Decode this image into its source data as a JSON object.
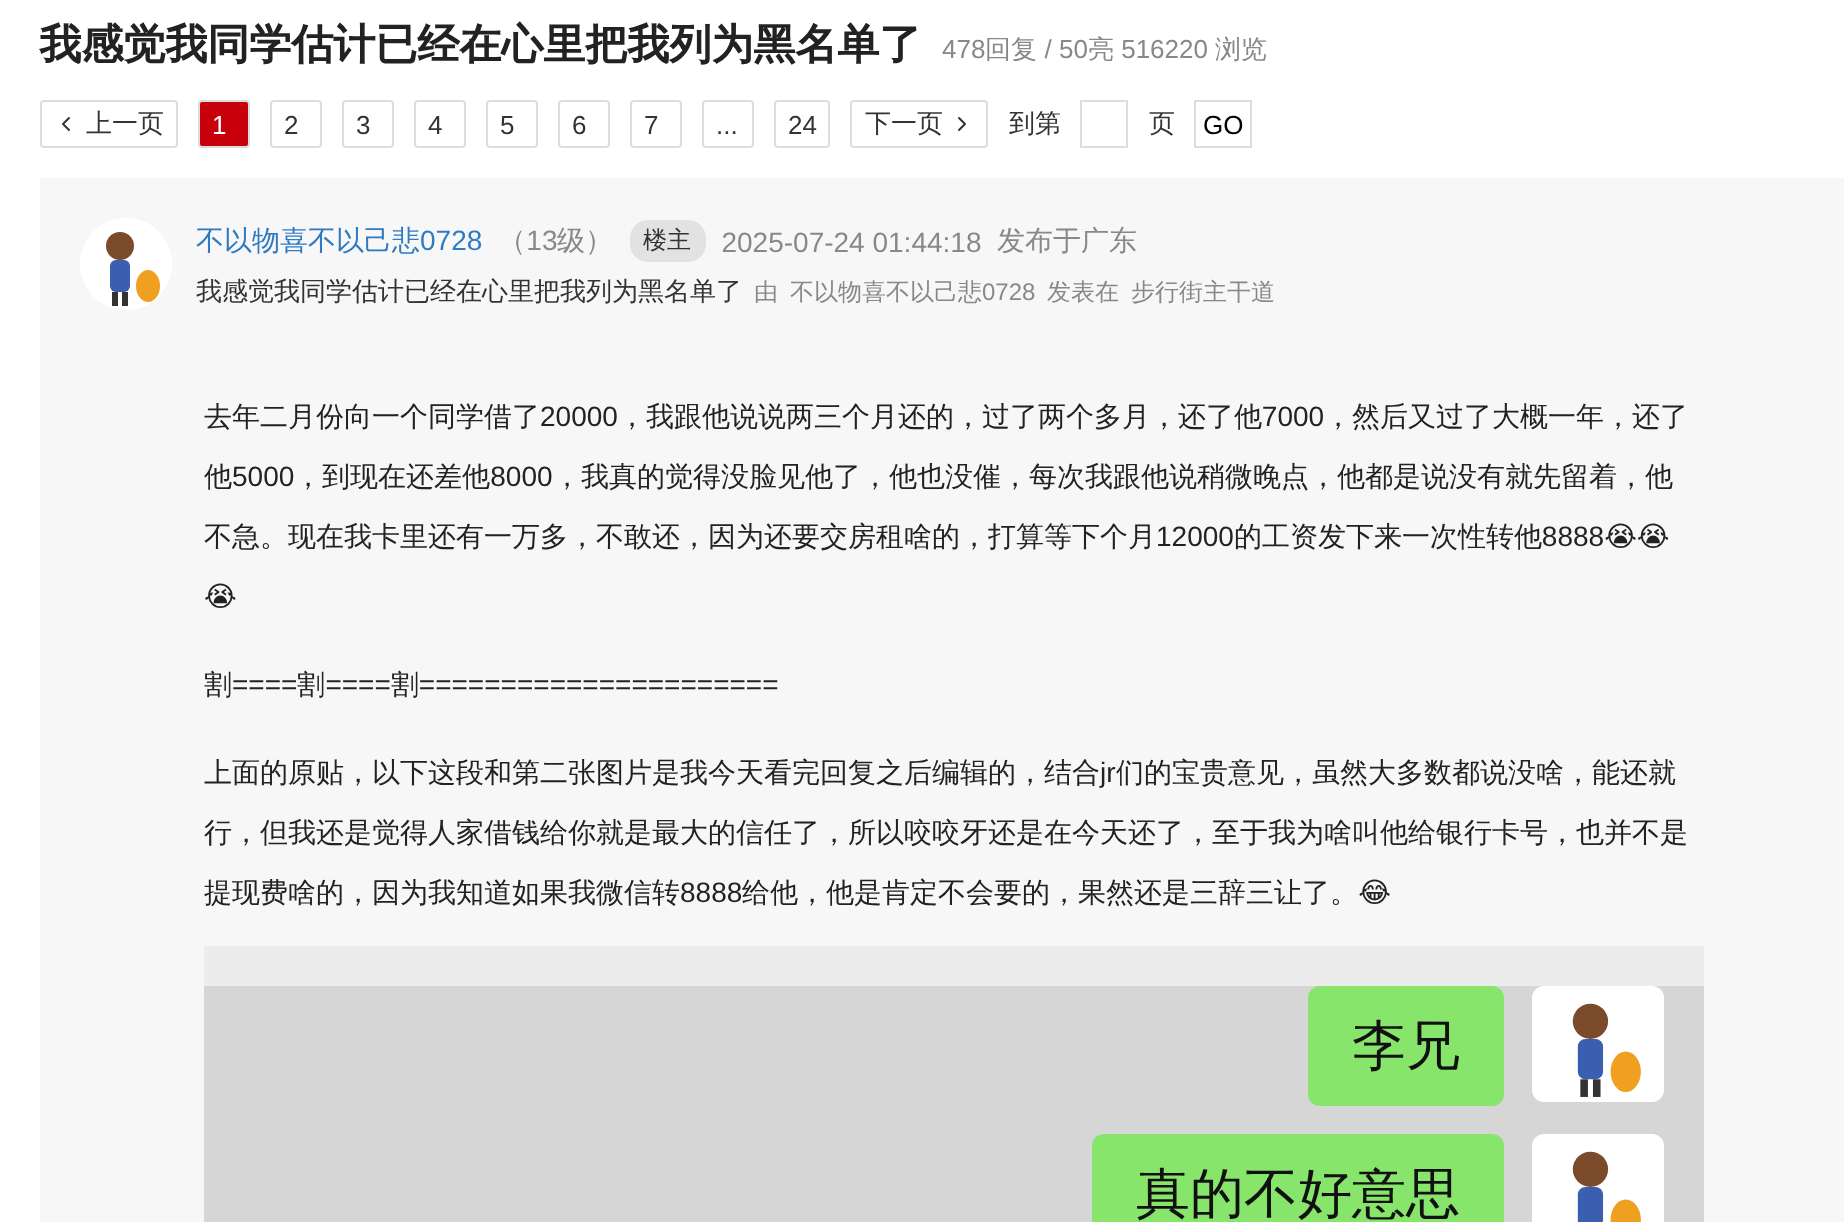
{
  "title": "我感觉我同学估计已经在心里把我列为黑名单了",
  "stats": "478回复 / 50亮 516220 浏览",
  "pagination": {
    "prev": "上一页",
    "pages": [
      {
        "label": "1",
        "selected": true
      },
      {
        "label": "2",
        "selected": false
      },
      {
        "label": "3",
        "selected": false
      },
      {
        "label": "4",
        "selected": false
      },
      {
        "label": "5",
        "selected": false
      },
      {
        "label": "6",
        "selected": false
      },
      {
        "label": "7",
        "selected": false
      },
      {
        "label": "...",
        "selected": false
      },
      {
        "label": "24",
        "selected": false
      }
    ],
    "next": "下一页",
    "goto_before": "到第",
    "goto_after": "页",
    "go": "GO"
  },
  "post": {
    "author": "不以物喜不以己悲0728",
    "level": "（13级）",
    "badge": "楼主",
    "time": "2025-07-24 01:44:18",
    "location": "发布于广东",
    "subject": "我感觉我同学估计已经在心里把我列为黑名单了",
    "by": "由",
    "by_author": "不以物喜不以己悲0728",
    "posted_in": "发表在",
    "forum": "步行街主干道",
    "paragraphs": [
      {
        "text": "去年二月份向一个同学借了20000，我跟他说说两三个月还的，过了两个多月，还了他7000，然后又过了大概一年，还了他5000，到现在还差他8000，我真的觉得没脸见他了，他也没催，每次我跟他说稍微晚点，他都是说没有就先留着，他不急。现在我卡里还有一万多，不敢还，因为还要交房租啥的，打算等下个月12000的工资发下来一次性转他8888😭😭😭"
      },
      {
        "text": "割====割====割======================"
      },
      {
        "text": "上面的原贴，以下这段和第二张图片是我今天看完回复之后编辑的，结合jr们的宝贵意见，虽然大多数都说没啥，能还就行，但我还是觉得人家借钱给你就是最大的信任了，所以咬咬牙还是在今天还了，至于我为啥叫他给银行卡号，也并不是提现费啥的，因为我知道如果我微信转8888给他，他是肯定不会要的，果然还是三辞三让了。😂"
      }
    ],
    "chat": [
      {
        "text": "李兄"
      },
      {
        "text": "真的不好意思"
      }
    ]
  }
}
